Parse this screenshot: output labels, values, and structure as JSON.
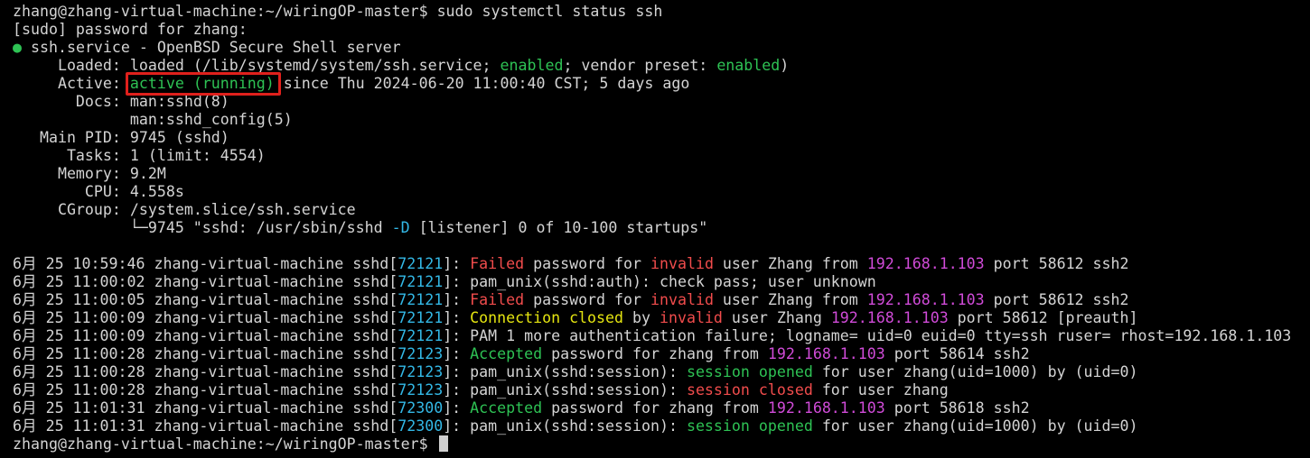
{
  "prompt": "zhang@zhang-virtual-machine:~/wiringOP-master$",
  "command": "sudo systemctl status ssh",
  "sudo_prompt": "[sudo] password for zhang:",
  "status": {
    "bullet": "●",
    "unit": "ssh.service - OpenBSD Secure Shell server",
    "loaded_label": "     Loaded:",
    "loaded_pre": "loaded (/lib/systemd/system/ssh.service;",
    "loaded_enabled": "enabled",
    "loaded_mid": "; vendor preset:",
    "loaded_preset": "enabled",
    "loaded_post": ")",
    "active_label": "     Active:",
    "active_state": "active (running)",
    "active_since": "since Thu 2024-06-20 11:00:40 CST; 5 days ago",
    "docs_label": "       Docs:",
    "docs_1": "man:sshd(8)",
    "docs_2": "             man:sshd_config(5)",
    "mainpid_label": "   Main PID:",
    "mainpid": "9745 (sshd)",
    "tasks_label": "      Tasks:",
    "tasks": "1 (limit: 4554)",
    "memory_label": "     Memory:",
    "memory": "9.2M",
    "cpu_label": "        CPU:",
    "cpu": "4.558s",
    "cgroup_label": "     CGroup:",
    "cgroup": "/system.slice/ssh.service",
    "cgroup_child_pre": "             └─9745 \"sshd: /usr/sbin/sshd ",
    "cgroup_child_flag": "-D",
    "cgroup_child_post": " [listener] 0 of 10-100 startups\""
  },
  "log": {
    "host": "zhang-virtual-machine",
    "proc": "sshd",
    "lines": [
      {
        "ts": "6月 25 10:59:46",
        "pid": "72121",
        "a": "Failed",
        "b": " password for ",
        "c": "invalid",
        "d": " user Zhang from ",
        "ip": "192.168.1.103",
        "e": " port 58612 ssh2"
      },
      {
        "ts": "6月 25 11:00:02",
        "pid": "72121",
        "text": "pam_unix(sshd:auth): check pass; user unknown"
      },
      {
        "ts": "6月 25 11:00:05",
        "pid": "72121",
        "a": "Failed",
        "b": " password for ",
        "c": "invalid",
        "d": " user Zhang from ",
        "ip": "192.168.1.103",
        "e": " port 58612 ssh2"
      },
      {
        "ts": "6月 25 11:00:09",
        "pid": "72121",
        "a": "Connection closed",
        "b": " by ",
        "c": "invalid",
        "d": " user Zhang ",
        "ip": "192.168.1.103",
        "e": " port 58612 [preauth]"
      },
      {
        "ts": "6月 25 11:00:09",
        "pid": "72121",
        "text": "PAM 1 more authentication failure; logname= uid=0 euid=0 tty=ssh ruser= rhost=192.168.1.103"
      },
      {
        "ts": "6月 25 11:00:28",
        "pid": "72123",
        "a": "Accepted",
        "b": " password for zhang from ",
        "ip": "192.168.1.103",
        "e": " port 58614 ssh2"
      },
      {
        "ts": "6月 25 11:00:28",
        "pid": "72123",
        "pre": "pam_unix(sshd:session): ",
        "s": "session opened",
        "post": " for user zhang(uid=1000) by (uid=0)"
      },
      {
        "ts": "6月 25 11:00:28",
        "pid": "72123",
        "pre": "pam_unix(sshd:session): ",
        "s": "session closed",
        "post": " for user zhang"
      },
      {
        "ts": "6月 25 11:01:31",
        "pid": "72300",
        "a": "Accepted",
        "b": " password for zhang from ",
        "ip": "192.168.1.103",
        "e": " port 58618 ssh2"
      },
      {
        "ts": "6月 25 11:01:31",
        "pid": "72300",
        "pre": "pam_unix(sshd:session): ",
        "s": "session opened",
        "post": " for user zhang(uid=1000) by (uid=0)"
      }
    ]
  },
  "colors": {
    "background": "#000000",
    "text": "#d4d4d4",
    "green": "#2ec254",
    "red": "#f14c4c",
    "magenta": "#d04bd8",
    "cyan": "#33b8e6",
    "yellow": "#e5e510",
    "highlight_box": "#e0201c"
  }
}
